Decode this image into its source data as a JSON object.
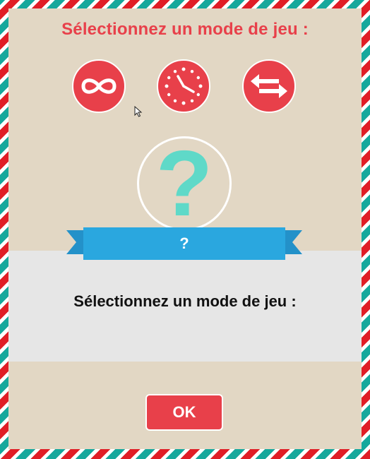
{
  "header": {
    "title": "Sélectionnez un mode de jeu :"
  },
  "modes": [
    {
      "id": "infinite",
      "icon": "infinity-icon"
    },
    {
      "id": "timer",
      "icon": "clock-icon"
    },
    {
      "id": "versus",
      "icon": "swap-arrows-icon"
    }
  ],
  "selected_mode": {
    "symbol": "?",
    "ribbon_label": "?"
  },
  "description": {
    "text": "Sélectionnez un mode de jeu :"
  },
  "footer": {
    "ok_label": "OK"
  },
  "colors": {
    "accent_red": "#e8404a",
    "teal": "#5fd9c8",
    "ribbon_blue": "#2aa7df",
    "background": "#e2d7c4"
  }
}
